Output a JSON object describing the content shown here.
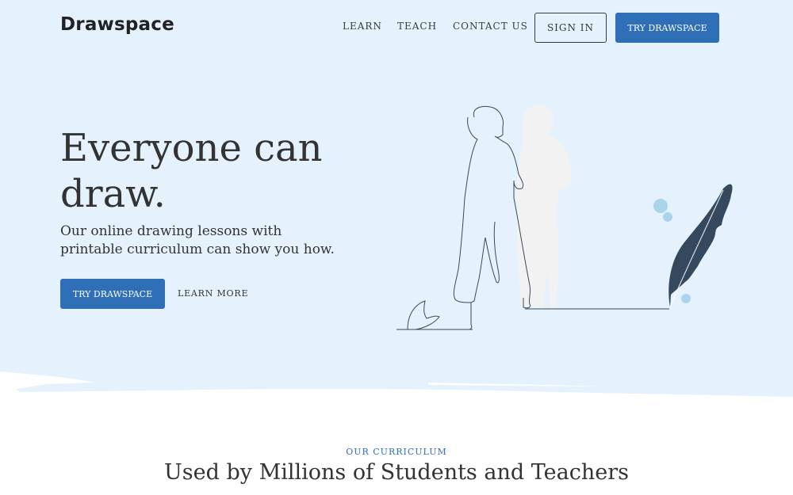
{
  "header": {
    "logo": "Drawspace",
    "nav": {
      "learn": "LEARN",
      "teach": "TEACH",
      "contact": "CONTACT US"
    },
    "sign_in": "SIGN IN",
    "try_button": "TRY DRAWSPACE"
  },
  "hero": {
    "headline": "Everyone can draw.",
    "subhead": "Our online drawing lessons with printable curriculum can show you how.",
    "cta_primary": "TRY DRAWSPACE",
    "cta_secondary": "LEARN MORE",
    "illustration": "woman-drawing-with-quill-icon"
  },
  "curriculum": {
    "eyebrow": "OUR CURRICULUM",
    "title": "Used by Millions of Students and Teachers"
  },
  "colors": {
    "hero_bg": "#e5f2fd",
    "accent": "#2f6fb7",
    "text": "#333333",
    "quill": "#34495e",
    "bubble": "#a9d4ec"
  }
}
